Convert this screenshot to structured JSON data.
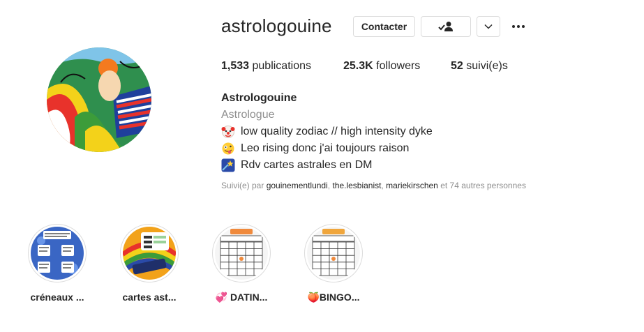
{
  "profile": {
    "username": "astrologouine",
    "contact_label": "Contacter",
    "stats": {
      "posts_count": "1,533",
      "posts_label": "publications",
      "followers_count": "25.3K",
      "followers_label": "followers",
      "following_count": "52",
      "following_label": "suivi(e)s"
    },
    "bio": {
      "name": "Astrologouine",
      "category": "Astrologue",
      "lines": [
        {
          "icon": "clown-face-emoji",
          "text": "low quality zodiac // high intensity dyke"
        },
        {
          "icon": "zany-face-emoji",
          "text": "Leo rising donc j'ai toujours raison"
        },
        {
          "icon": "shooting-star-emoji",
          "text": "Rdv cartes astrales en DM"
        }
      ]
    },
    "followed_by": {
      "prefix": "Suivi(e) par ",
      "users": [
        "gouinementlundi",
        "the.lesbianist",
        "mariekirschen"
      ],
      "suffix": " et 74 autres personnes"
    }
  },
  "highlights": [
    {
      "label": "créneaux ...",
      "icon": "calendar-text-thumbnail"
    },
    {
      "label": "cartes ast...",
      "icon": "rainbow-chart-thumbnail"
    },
    {
      "label": "💞 DATIN...",
      "icon": "bingo-card-thumbnail"
    },
    {
      "label": "🍑BINGO...",
      "icon": "bingo-card-thumbnail"
    }
  ],
  "colors": {
    "text": "#262626",
    "secondary": "#8e8e8e",
    "border": "#dbdbdb"
  }
}
